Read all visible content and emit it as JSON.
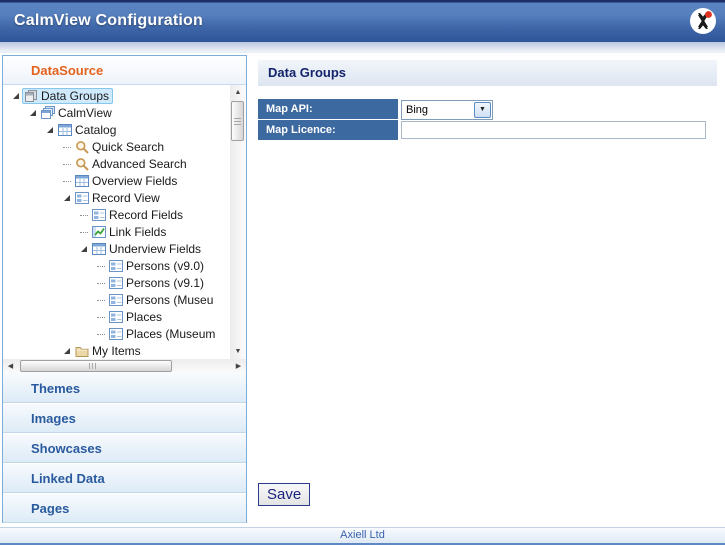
{
  "titlebar": {
    "title": "CalmView Configuration"
  },
  "sidebar": {
    "header_label": "DataSource",
    "tree": [
      {
        "label": "Data Groups",
        "level": 0,
        "icon": "data-groups-icon",
        "expanded": true,
        "selected": true
      },
      {
        "label": "CalmView",
        "level": 1,
        "icon": "stacked-tables-icon",
        "expanded": true
      },
      {
        "label": "Catalog",
        "level": 2,
        "icon": "table-icon",
        "expanded": true
      },
      {
        "label": "Quick Search",
        "level": 3,
        "icon": "search-icon"
      },
      {
        "label": "Advanced Search",
        "level": 3,
        "icon": "search-icon"
      },
      {
        "label": "Overview Fields",
        "level": 3,
        "icon": "table-icon"
      },
      {
        "label": "Record View",
        "level": 3,
        "icon": "form-icon",
        "expanded": true
      },
      {
        "label": "Record Fields",
        "level": 4,
        "icon": "form-icon"
      },
      {
        "label": "Link Fields",
        "level": 4,
        "icon": "link-chart-icon"
      },
      {
        "label": "Underview Fields",
        "level": 4,
        "icon": "table-icon",
        "expanded": true
      },
      {
        "label": "Persons (v9.0)",
        "level": 5,
        "icon": "form-icon"
      },
      {
        "label": "Persons (v9.1)",
        "level": 5,
        "icon": "form-icon"
      },
      {
        "label": "Persons (Museu",
        "level": 5,
        "icon": "form-icon"
      },
      {
        "label": "Places",
        "level": 5,
        "icon": "form-icon"
      },
      {
        "label": "Places (Museum",
        "level": 5,
        "icon": "form-icon"
      },
      {
        "label": "My Items",
        "level": 3,
        "icon": "folder-icon",
        "expanded": true
      }
    ],
    "sections": [
      {
        "label": "Themes"
      },
      {
        "label": "Images"
      },
      {
        "label": "Showcases"
      },
      {
        "label": "Linked Data"
      },
      {
        "label": "Pages"
      }
    ]
  },
  "main": {
    "header_label": "Data Groups",
    "form": {
      "map_api": {
        "label": "Map API:",
        "value": "Bing"
      },
      "map_licence": {
        "label": "Map Licence:",
        "value": ""
      }
    },
    "save_label": "Save"
  },
  "footer": {
    "text": "Axiell Ltd"
  },
  "colors": {
    "banner_blue": "#3e67aa",
    "datasource_orange": "#e4621d",
    "form_label_bg": "#3d69a1",
    "accordion_text": "#2a5a9e",
    "panel_header_text": "#13246b",
    "save_text": "#1a2280",
    "selection_bg": "#cfeafc",
    "footer_text": "#3b62b0",
    "logo_red": "#e03020"
  }
}
